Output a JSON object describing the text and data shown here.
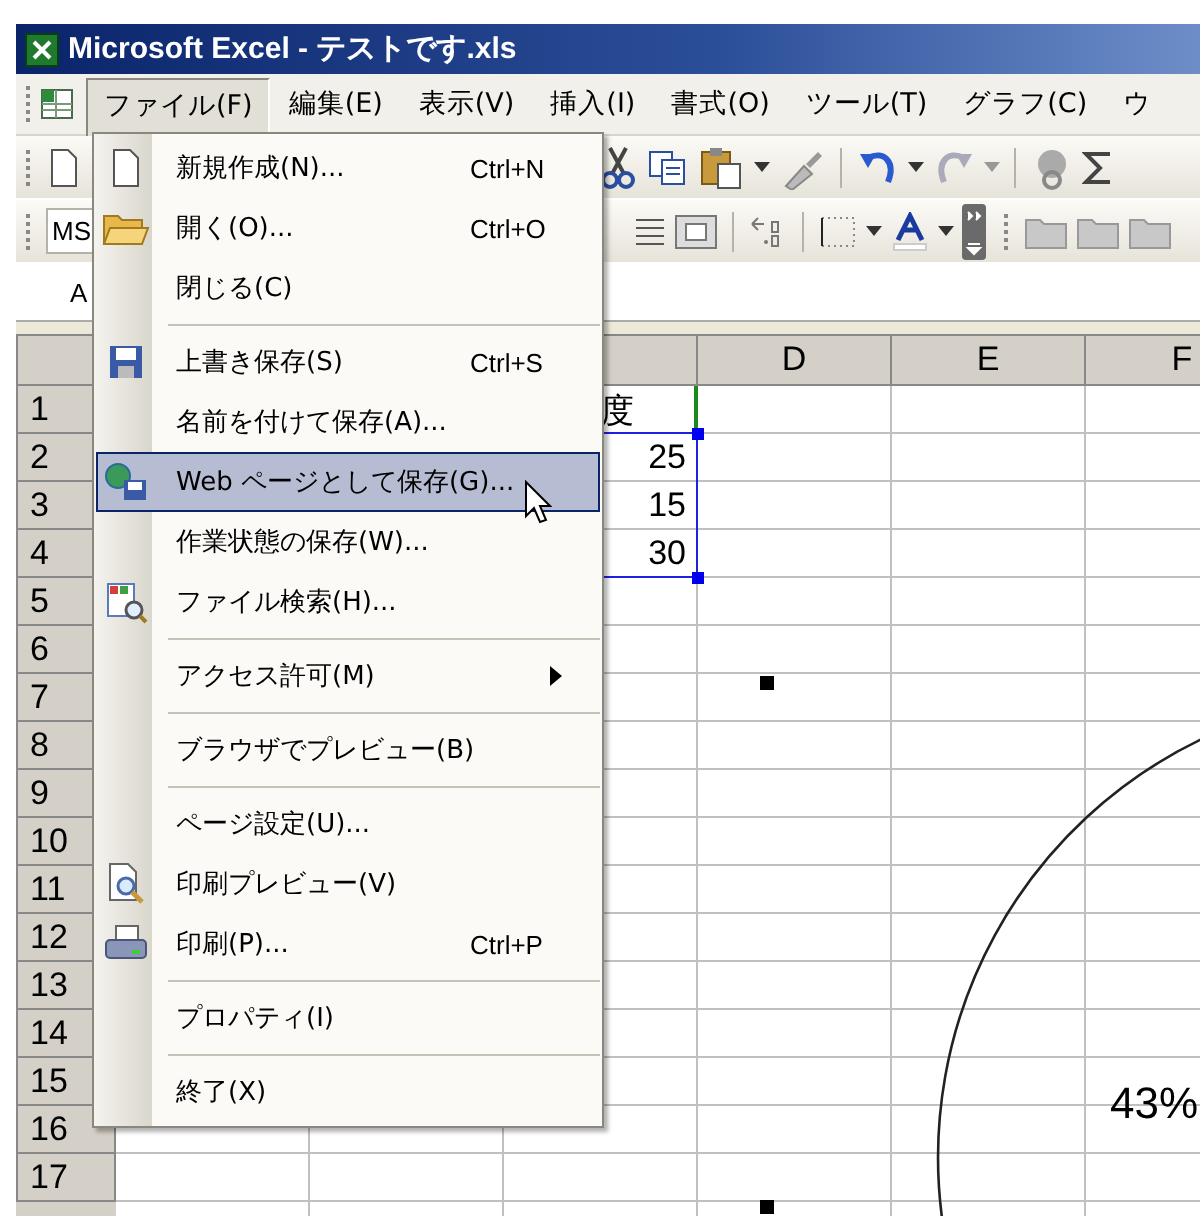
{
  "window": {
    "title": "Microsoft Excel - テストです.xls"
  },
  "menu_bar": [
    {
      "label": "ファイル(F)",
      "selected": true
    },
    {
      "label": "編集(E)",
      "selected": false
    },
    {
      "label": "表示(V)",
      "selected": false
    },
    {
      "label": "挿入(I)",
      "selected": false
    },
    {
      "label": "書式(O)",
      "selected": false
    },
    {
      "label": "ツール(T)",
      "selected": false
    },
    {
      "label": "グラフ(C)",
      "selected": false
    },
    {
      "label": "ウ",
      "selected": false
    }
  ],
  "font_field": "MS",
  "name_box": "A",
  "file_menu": [
    [
      {
        "label": "新規作成(N)...",
        "shortcut": "Ctrl+N",
        "kind": "new",
        "submenu": false,
        "selected": false
      },
      {
        "label": "開く(O)...",
        "shortcut": "Ctrl+O",
        "kind": "open",
        "submenu": false,
        "selected": false
      },
      {
        "label": "閉じる(C)",
        "submenu": false,
        "selected": false
      }
    ],
    [
      {
        "label": "上書き保存(S)",
        "shortcut": "Ctrl+S",
        "kind": "save",
        "submenu": false,
        "selected": false
      },
      {
        "label": "名前を付けて保存(A)...",
        "submenu": false,
        "selected": false
      },
      {
        "label": "Web ページとして保存(G)...",
        "kind": "web",
        "submenu": false,
        "selected": true
      },
      {
        "label": "作業状態の保存(W)...",
        "submenu": false,
        "selected": false
      },
      {
        "label": "ファイル検索(H)...",
        "kind": "search",
        "submenu": false,
        "selected": false
      }
    ],
    [
      {
        "label": "アクセス許可(M)",
        "submenu": true,
        "selected": false
      }
    ],
    [
      {
        "label": "ブラウザでプレビュー(B)",
        "submenu": false,
        "selected": false
      }
    ],
    [
      {
        "label": "ページ設定(U)...",
        "submenu": false,
        "selected": false
      },
      {
        "label": "印刷プレビュー(V)",
        "kind": "preview",
        "submenu": false,
        "selected": false
      },
      {
        "label": "印刷(P)...",
        "shortcut": "Ctrl+P",
        "kind": "print",
        "submenu": false,
        "selected": false
      }
    ],
    [
      {
        "label": "プロパティ(I)",
        "submenu": false,
        "selected": false
      }
    ],
    [
      {
        "label": "終了(X)",
        "submenu": false,
        "selected": false
      }
    ]
  ],
  "sheet": {
    "columns": [
      "D",
      "E",
      "F"
    ],
    "rows": [
      "1",
      "2",
      "3",
      "4",
      "5",
      "6",
      "7",
      "8",
      "9",
      "10",
      "11",
      "12",
      "13",
      "14",
      "15",
      "16",
      "17"
    ],
    "column_c": [
      {
        "value": "度",
        "kind": "text"
      },
      {
        "value": "25",
        "kind": "number"
      },
      {
        "value": "15",
        "kind": "number"
      },
      {
        "value": "30",
        "kind": "number"
      }
    ]
  },
  "chart": {
    "data_label": "43%"
  }
}
